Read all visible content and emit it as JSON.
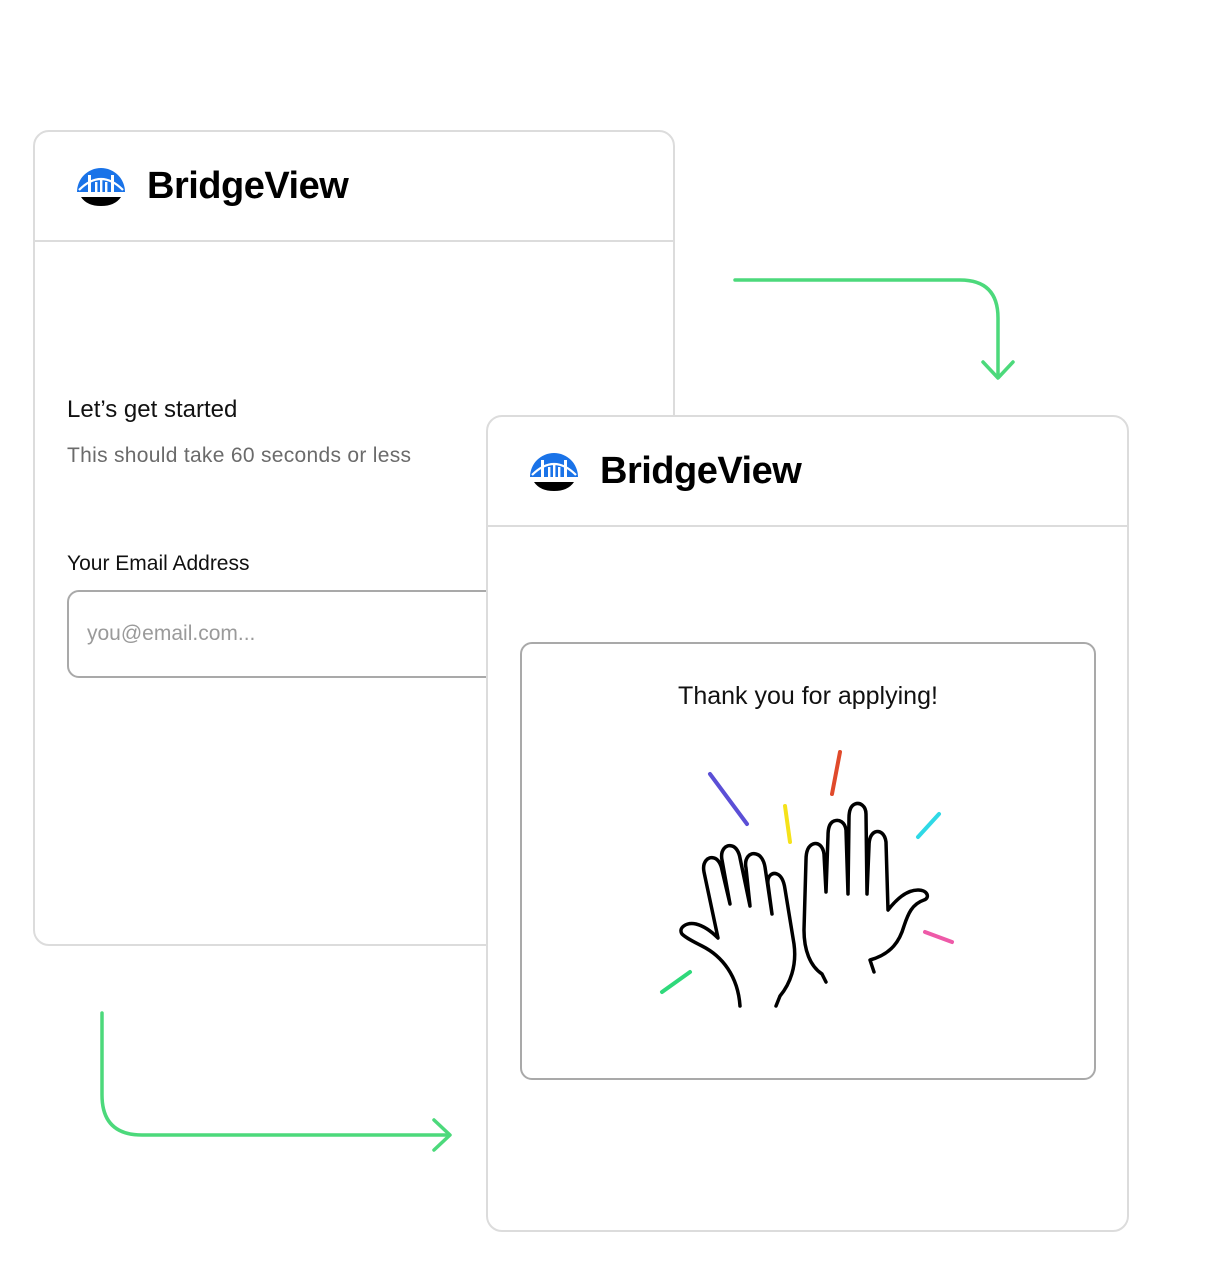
{
  "brand": {
    "name": "BridgeView",
    "logo_icon": "bridge-logo-icon",
    "logo_color": "#1a73e8"
  },
  "start_card": {
    "title": "Let’s get started",
    "subtitle": "This should take 60 seconds or less",
    "email_label": "Your Email Address",
    "email_placeholder": "you@email.com...",
    "email_value": ""
  },
  "thanks_card": {
    "message": "Thank you for applying!",
    "illustration_icon": "high-five-icon"
  },
  "flow_arrows": {
    "color": "#4cd97b",
    "icons": [
      "flow-arrow-right-down-icon",
      "flow-arrow-down-right-icon"
    ]
  }
}
